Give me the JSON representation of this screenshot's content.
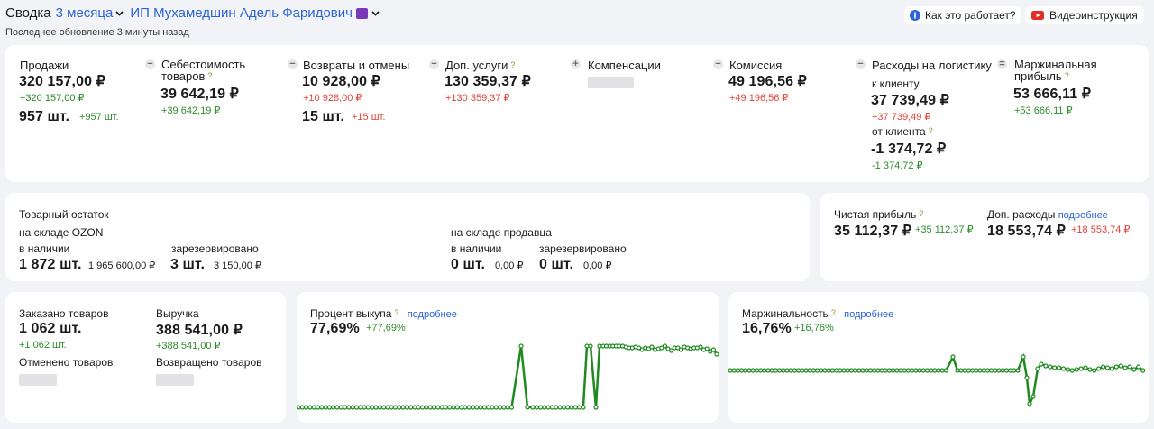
{
  "header": {
    "title": "Сводка",
    "period": "3 месяца",
    "seller": "ИП Мухамедшин Адель Фаридович",
    "last_update": "Последнее обновление 3 минуты назад",
    "how_it_works": "Как это работает?",
    "video": "Видеоинструкция"
  },
  "metrics": {
    "sales": {
      "label": "Продажи",
      "value": "320 157,00 ₽",
      "delta": "+320 157,00 ₽",
      "qty": "957 шт.",
      "qty_delta": "+957 шт."
    },
    "cost": {
      "label_line1": "Себестоимость",
      "label_line2": "товаров",
      "help": "?",
      "value": "39 642,19 ₽",
      "delta": "+39 642,19 ₽"
    },
    "returns": {
      "label": "Возвраты и отмены",
      "value": "10 928,00 ₽",
      "delta": "+10 928,00 ₽",
      "qty": "15 шт.",
      "qty_delta": "+15 шт."
    },
    "services": {
      "label": "Доп. услуги",
      "help": "?",
      "value": "130 359,37 ₽",
      "delta": "+130 359,37 ₽"
    },
    "compensation": {
      "label": "Компенсации"
    },
    "commission": {
      "label": "Комиссия",
      "value": "49 196,56 ₽",
      "delta": "+49 196,56 ₽"
    },
    "logistics": {
      "label": "Расходы на логистику",
      "to_client_label": "к клиенту",
      "to_client_value": "37 739,49 ₽",
      "to_client_delta": "+37 739,49 ₽",
      "from_client_label": "от клиента",
      "from_client_help": "?",
      "from_client_value": "-1 374,72 ₽",
      "from_client_delta": "-1 374,72 ₽"
    },
    "margin_profit": {
      "label_line1": "Маржинальная",
      "label_line2": "прибыль",
      "help": "?",
      "value": "53 666,11 ₽",
      "delta": "+53 666,11 ₽"
    }
  },
  "stock": {
    "title": "Товарный остаток",
    "ozon_label": "на складе OZON",
    "seller_label": "на складе продавца",
    "available": "в наличии",
    "reserved": "зарезервировано",
    "ozon_avail_qty": "1 872 шт.",
    "ozon_avail_sum": "1 965 600,00 ₽",
    "ozon_res_qty": "3 шт.",
    "ozon_res_sum": "3 150,00 ₽",
    "seller_avail_qty": "0 шт.",
    "seller_avail_sum": "0,00 ₽",
    "seller_res_qty": "0 шт.",
    "seller_res_sum": "0,00 ₽"
  },
  "profit": {
    "net_label": "Чистая прибыль",
    "net_help": "?",
    "net_value": "35 112,37 ₽",
    "net_delta": "+35 112,37 ₽",
    "extra_label": "Доп. расходы",
    "extra_link": "подробнее",
    "extra_value": "18 553,74 ₽",
    "extra_delta": "+18 553,74 ₽"
  },
  "orders": {
    "ordered_label": "Заказано товаров",
    "ordered_value": "1 062 шт.",
    "ordered_delta": "+1 062 шт.",
    "revenue_label": "Выручка",
    "revenue_value": "388 541,00 ₽",
    "revenue_delta": "+388 541,00 ₽",
    "cancelled_label": "Отменено товаров",
    "returned_label": "Возвращено товаров"
  },
  "buyout": {
    "label": "Процент выкупа",
    "help": "?",
    "link": "подробнее",
    "value": "77,69%",
    "delta": "+77,69%"
  },
  "marginality": {
    "label": "Маржинальность",
    "help": "?",
    "link": "подробнее",
    "value": "16,76%",
    "delta": "+16,76%"
  },
  "colors": {
    "green": "#2e8b2e",
    "red": "#e0443a",
    "blue": "#2b63d9",
    "line": "#1f8a1f"
  },
  "icons": [
    "chevron-down-icon",
    "ozon-badge-icon",
    "info-icon",
    "youtube-icon",
    "minus-icon",
    "plus-icon",
    "help-icon"
  ]
}
